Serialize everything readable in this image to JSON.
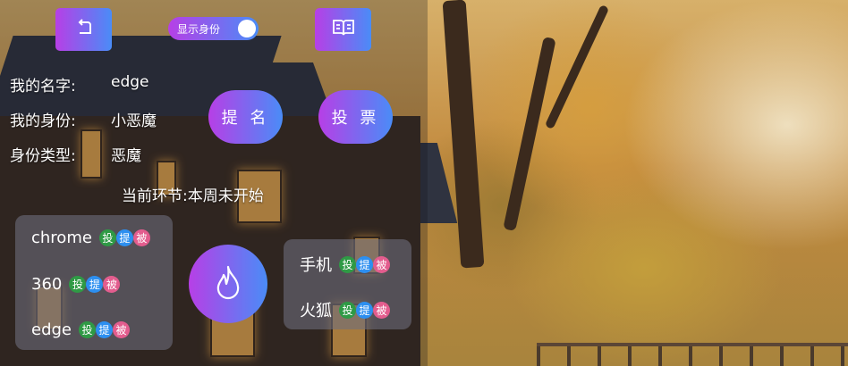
{
  "toolbar": {
    "back_icon": "return-icon",
    "toggle_label": "显示身份",
    "toggle_on": true,
    "book_icon": "book-icon"
  },
  "info": {
    "name_key": "我的名字:",
    "name_val": "edge",
    "identity_key": "我的身份:",
    "identity_val": "小恶魔",
    "type_key": "身份类型:",
    "type_val": "恶魔"
  },
  "actions": {
    "nominate": "提 名",
    "vote": "投 票"
  },
  "stage_text": "当前环节:本周未开始",
  "tags": {
    "vote": "投",
    "nominate": "提",
    "nominated": "被"
  },
  "left_players": [
    {
      "name": "chrome"
    },
    {
      "name": "360"
    },
    {
      "name": "edge"
    }
  ],
  "right_players": [
    {
      "name": "手机"
    },
    {
      "name": "火狐"
    }
  ],
  "center_icon": "fire-icon",
  "colors": {
    "gradient_start": "#b73fe6",
    "gradient_end": "#4a8cf7"
  }
}
